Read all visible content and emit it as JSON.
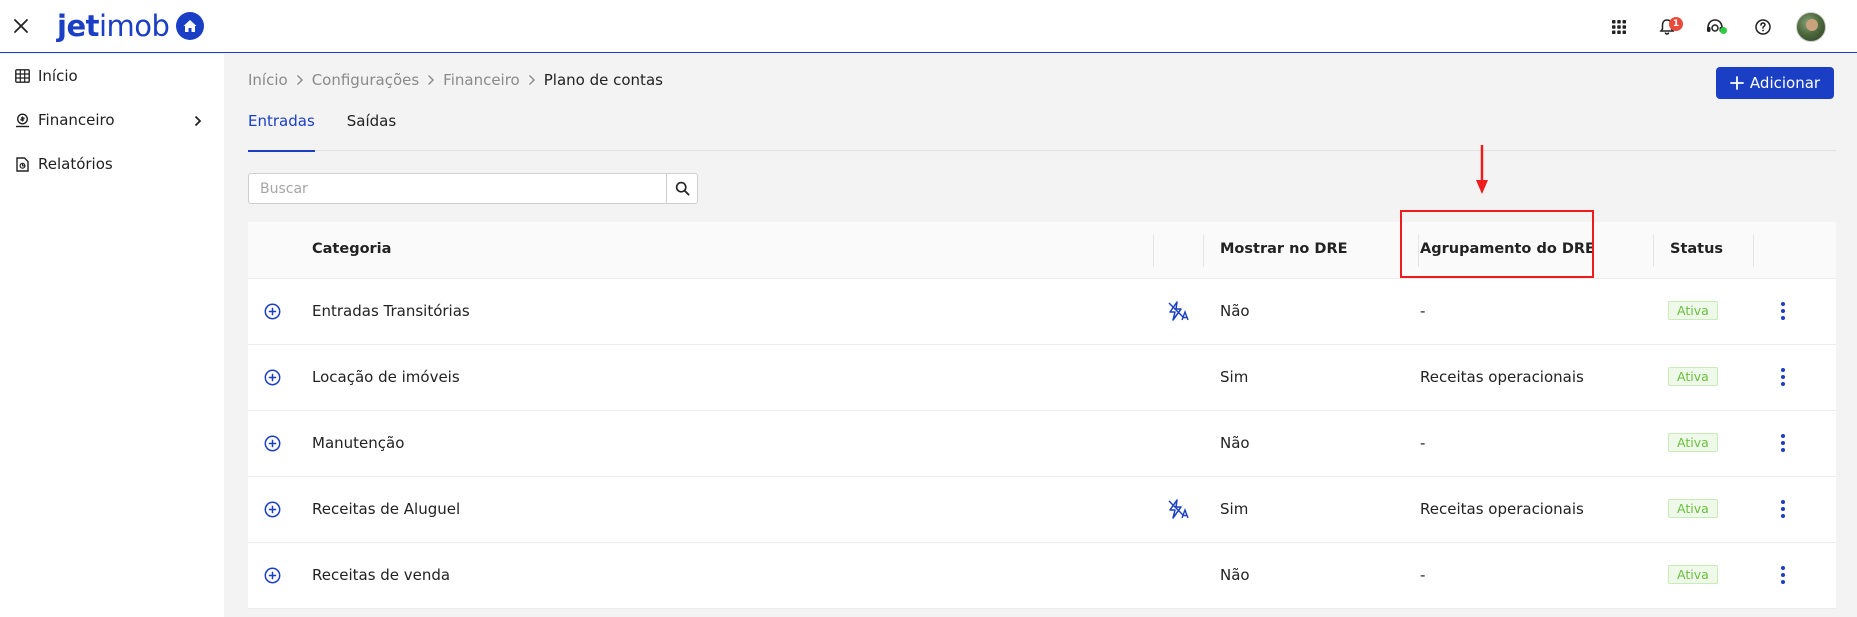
{
  "brand": {
    "logo_bold": "jet",
    "logo_light": "imob"
  },
  "colors": {
    "accent": "#1a3fc4",
    "status_green": "#6abf3e",
    "annotation_red": "#ee1c1c",
    "badge_red": "#e74c3c"
  },
  "topbar": {
    "icons": [
      "apps-grid-icon",
      "bell-icon",
      "support-agent-icon",
      "help-icon",
      "avatar"
    ],
    "notification_count": "1"
  },
  "sidebar": {
    "items": [
      {
        "label": "Início",
        "icon": "table-grid-icon"
      },
      {
        "label": "Financeiro",
        "icon": "finance-icon"
      },
      {
        "label": "Relatórios",
        "icon": "report-icon"
      }
    ]
  },
  "breadcrumb": {
    "items": [
      "Início",
      "Configurações",
      "Financeiro"
    ],
    "current": "Plano de contas"
  },
  "actions": {
    "add_label": "Adicionar"
  },
  "tabs": [
    {
      "label": "Entradas",
      "active": true
    },
    {
      "label": "Saídas",
      "active": false
    }
  ],
  "search": {
    "placeholder": "Buscar",
    "value": ""
  },
  "table": {
    "headers": {
      "category": "Categoria",
      "show_dre": "Mostrar no DRE",
      "dre_group": "Agrupamento do DRE",
      "status": "Status"
    },
    "rows": [
      {
        "category": "Entradas Transitórias",
        "automatic": true,
        "show_dre": "Não",
        "dre_group": "-",
        "status": "Ativa"
      },
      {
        "category": "Locação de imóveis",
        "automatic": false,
        "show_dre": "Sim",
        "dre_group": "Receitas operacionais",
        "status": "Ativa"
      },
      {
        "category": "Manutenção",
        "automatic": false,
        "show_dre": "Não",
        "dre_group": "-",
        "status": "Ativa"
      },
      {
        "category": "Receitas de Aluguel",
        "automatic": true,
        "show_dre": "Sim",
        "dre_group": "Receitas operacionais",
        "status": "Ativa"
      },
      {
        "category": "Receitas de venda",
        "automatic": false,
        "show_dre": "Não",
        "dre_group": "-",
        "status": "Ativa"
      }
    ]
  }
}
